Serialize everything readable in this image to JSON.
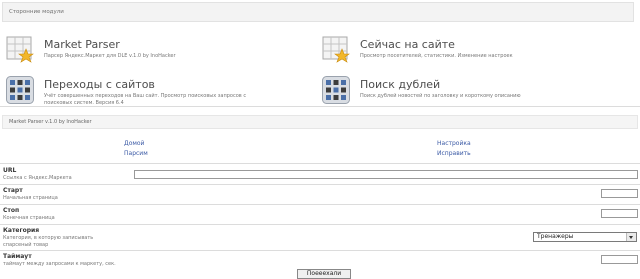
{
  "third_party": {
    "title": "Сторонние модули",
    "modules": [
      {
        "title": "Market Parser",
        "desc": "Парсер Яндекс.Маркет для DLE v.1.0 by InoHacker"
      },
      {
        "title": "Сейчас на сайте",
        "desc": "Просмотр посетителей, статистики. Изменение настроек"
      },
      {
        "title": "Переходы с сайтов",
        "desc": "Учёт совершенных переходов на Ваш сайт. Просмотр поисковых запросов с поисковых систем. Версия 6.4"
      },
      {
        "title": "Поиск дублей",
        "desc": "Поиск дублей новостей по заголовку и короткому описанию"
      }
    ]
  },
  "market_parser": {
    "title": "Market Parser v.1.0 by InoHacker",
    "nav": {
      "home": "Домой",
      "parse": "Парсим",
      "settings": "Настройка",
      "fix": "Исправить"
    },
    "fields": {
      "url": {
        "label": "URL",
        "hint": "Ссылка с Яндекс.Маркета",
        "value": ""
      },
      "start": {
        "label": "Старт",
        "hint": "Начальная страница",
        "value": ""
      },
      "stop": {
        "label": "Стоп",
        "hint": "Конечная страница",
        "value": ""
      },
      "category": {
        "label": "Категория",
        "hint": "Категория, в которую записывать спарсеный товар",
        "selected": "Тренажеры"
      },
      "timeout": {
        "label": "Таймаут",
        "hint": "таймаут между запросами к маркету, сек.",
        "value": ""
      }
    },
    "submit_label": "Поееехали"
  },
  "colors": {
    "link": "#3a59a5",
    "panel_header_bg": "#f3f3f3"
  }
}
